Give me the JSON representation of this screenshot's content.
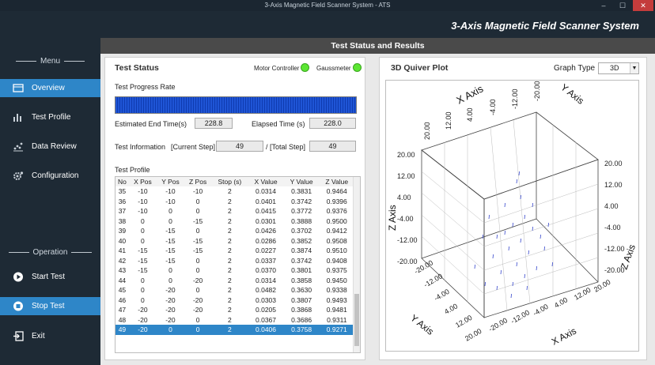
{
  "window": {
    "title": "3-Axis Magnetic Field Scanner System - ATS",
    "minimize": "–",
    "maximize": "☐",
    "close": "✕"
  },
  "app_title": "3-Axis Magnetic Field Scanner System",
  "sidebar": {
    "menu_heading": "Menu",
    "items": [
      {
        "label": "Overview",
        "icon": "overview-icon"
      },
      {
        "label": "Test Profile",
        "icon": "bar-chart-icon"
      },
      {
        "label": "Data Review",
        "icon": "scatter-chart-icon"
      },
      {
        "label": "Configuration",
        "icon": "gear-icon"
      }
    ],
    "operation_heading": "Operation",
    "ops": [
      {
        "label": "Start Test",
        "icon": "play-icon"
      },
      {
        "label": "Stop Test",
        "icon": "stop-icon"
      },
      {
        "label": "Exit",
        "icon": "exit-icon"
      }
    ]
  },
  "main_header": "Test Status and Results",
  "status": {
    "title": "Test Status",
    "motor_label": "Motor Controller",
    "gauss_label": "Gaussmeter",
    "led_color": "#5ce633",
    "progress_label": "Test Progress Rate",
    "progress": 1.0,
    "end_time_label": "Estimated End Time(s)",
    "end_time": "228.8",
    "elapsed_label": "Elapsed Time (s)",
    "elapsed": "228.0",
    "info_label": "Test Information",
    "current_step_label": "[Current Step]",
    "current_step": "49",
    "total_step_label": "/ [Total Step]",
    "total_step": "49",
    "profile_label": "Test Profile",
    "columns": [
      "No",
      "X Pos",
      "Y Pos",
      "Z Pos",
      "Stop (s)",
      "X Value",
      "Y Value",
      "Z Value"
    ],
    "rows": [
      [
        "35",
        "-10",
        "-10",
        "-10",
        "2",
        "0.0314",
        "0.3831",
        "0.9464"
      ],
      [
        "36",
        "-10",
        "-10",
        "0",
        "2",
        "0.0401",
        "0.3742",
        "0.9396"
      ],
      [
        "37",
        "-10",
        "0",
        "0",
        "2",
        "0.0415",
        "0.3772",
        "0.9376"
      ],
      [
        "38",
        "0",
        "0",
        "-15",
        "2",
        "0.0301",
        "0.3888",
        "0.9500"
      ],
      [
        "39",
        "0",
        "-15",
        "0",
        "2",
        "0.0426",
        "0.3702",
        "0.9412"
      ],
      [
        "40",
        "0",
        "-15",
        "-15",
        "2",
        "0.0286",
        "0.3852",
        "0.9508"
      ],
      [
        "41",
        "-15",
        "-15",
        "-15",
        "2",
        "0.0227",
        "0.3874",
        "0.9510"
      ],
      [
        "42",
        "-15",
        "-15",
        "0",
        "2",
        "0.0337",
        "0.3742",
        "0.9408"
      ],
      [
        "43",
        "-15",
        "0",
        "0",
        "2",
        "0.0370",
        "0.3801",
        "0.9375"
      ],
      [
        "44",
        "0",
        "0",
        "-20",
        "2",
        "0.0314",
        "0.3858",
        "0.9450"
      ],
      [
        "45",
        "0",
        "-20",
        "0",
        "2",
        "0.0482",
        "0.3630",
        "0.9338"
      ],
      [
        "46",
        "0",
        "-20",
        "-20",
        "2",
        "0.0303",
        "0.3807",
        "0.9493"
      ],
      [
        "47",
        "-20",
        "-20",
        "-20",
        "2",
        "0.0205",
        "0.3868",
        "0.9481"
      ],
      [
        "48",
        "-20",
        "-20",
        "0",
        "2",
        "0.0367",
        "0.3686",
        "0.9311"
      ],
      [
        "49",
        "-20",
        "0",
        "0",
        "2",
        "0.0406",
        "0.3758",
        "0.9271"
      ]
    ],
    "selected_row": "49"
  },
  "plot": {
    "title": "3D Quiver Plot",
    "graph_type_label": "Graph Type",
    "graph_type_value": "3D",
    "x_axis": "X Axis",
    "y_axis": "Y Axis",
    "z_axis": "Z Axis",
    "ticks": [
      "20.00",
      "12.00",
      "4.00",
      "-4.00",
      "-12.00",
      "-20.00"
    ],
    "arrow_color": "#3344cc"
  }
}
